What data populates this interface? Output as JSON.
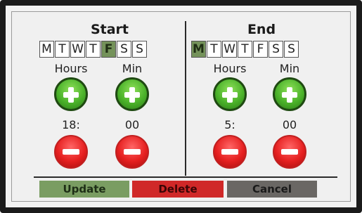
{
  "start": {
    "title": "Start",
    "days": [
      "M",
      "T",
      "W",
      "T",
      "F",
      "S",
      "S"
    ],
    "selected_day": "F",
    "hours_label": "Hours",
    "min_label": "Min",
    "hours_value": "18:",
    "min_value": "00"
  },
  "end": {
    "title": "End",
    "days": [
      "M",
      "T",
      "W",
      "T",
      "F",
      "S",
      "S"
    ],
    "selected_day": "M",
    "hours_label": "Hours",
    "min_label": "Min",
    "hours_value": "5:",
    "min_value": "00"
  },
  "actions": {
    "update_label": "Update",
    "delete_label": "Delete",
    "cancel_label": "Cancel"
  },
  "colors": {
    "selected_day": "#74925a",
    "plus_button": "#4bb22a",
    "minus_button": "#e62020",
    "update_button": "#7a9d62",
    "delete_button": "#d02828",
    "cancel_button": "#6a6764"
  },
  "icons": {
    "increment": "plus-icon",
    "decrement": "minus-icon"
  }
}
